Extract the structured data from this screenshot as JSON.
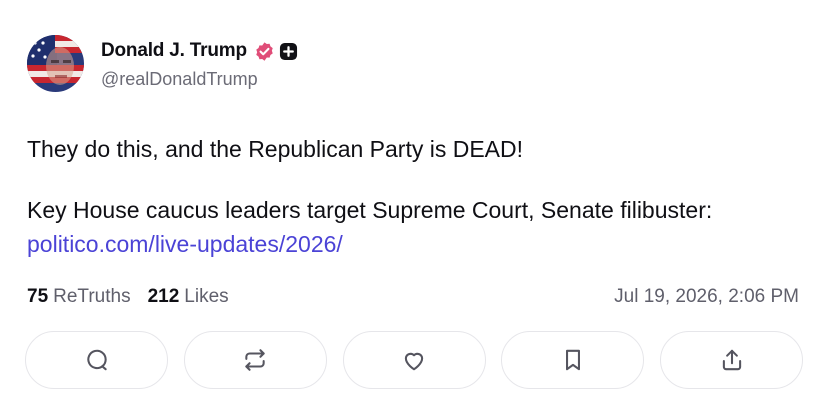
{
  "author": {
    "display_name": "Donald J. Trump",
    "handle": "@realDonaldTrump",
    "avatar_icon": "avatar-flag-portrait",
    "verified_icon": "verified-badge-icon",
    "verified_color": "#e04d78",
    "plus_icon": "plus-badge-icon"
  },
  "post": {
    "line1": "They do this, and the Republican Party is DEAD!",
    "line2_prefix": "Key House caucus leaders target Supreme Court, Senate filibuster: ",
    "link_text": "politico.com/live-updates/2026/",
    "link_color": "#4b43d6"
  },
  "stats": {
    "retruths_count": "75",
    "retruths_label": "ReTruths",
    "likes_count": "212",
    "likes_label": "Likes",
    "timestamp": "Jul 19, 2026, 2:06 PM"
  },
  "actions": [
    {
      "icon": "reply-icon"
    },
    {
      "icon": "retruth-icon"
    },
    {
      "icon": "like-heart-icon"
    },
    {
      "icon": "bookmark-icon"
    },
    {
      "icon": "share-upload-icon"
    }
  ]
}
